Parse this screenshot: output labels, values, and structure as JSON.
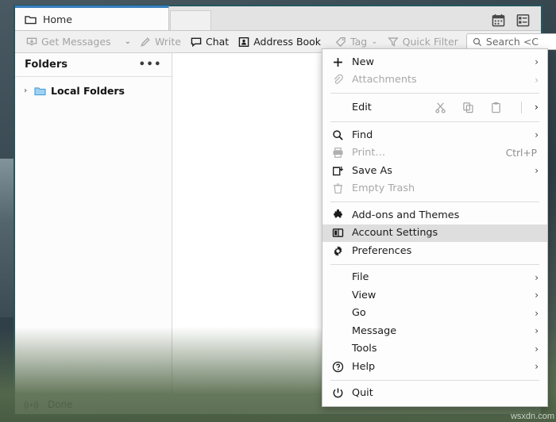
{
  "window": {
    "tabs": [
      {
        "label": "Home",
        "icon": "folder-icon",
        "active": true
      },
      {
        "label": "",
        "icon": "",
        "active": false
      }
    ],
    "tab_icons": [
      {
        "name": "calendar-icon"
      },
      {
        "name": "tasks-icon"
      }
    ]
  },
  "toolbar": {
    "get_messages": "Get Messages",
    "get_messages_caret": "⌄",
    "write": "Write",
    "chat": "Chat",
    "address_book": "Address Book",
    "tag": "Tag",
    "tag_caret": "⌄",
    "quick_filter": "Quick Filter",
    "search_value": "Search <C",
    "search_placeholder": "Search <Ctrl+K>",
    "menu_button": "app-menu-button"
  },
  "sidebar": {
    "title": "Folders",
    "more_label": "•••",
    "tree": [
      {
        "label": "Local Folders",
        "twisty": "›",
        "icon": "folder-icon"
      }
    ]
  },
  "statusbar": {
    "text": "Done",
    "icon": "activity-icon"
  },
  "appmenu": {
    "groups": [
      {
        "items": [
          {
            "label": "New",
            "icon": "plus-icon",
            "arrow": "›",
            "disabled": false,
            "selected": false,
            "accel": ""
          },
          {
            "label": "Attachments",
            "icon": "paperclip-icon",
            "arrow": "›",
            "disabled": true,
            "selected": false,
            "accel": ""
          }
        ]
      },
      {
        "edit_row": {
          "label": "Edit",
          "arrow": "›",
          "icons": [
            {
              "name": "cut-icon"
            },
            {
              "name": "copy-icon"
            },
            {
              "name": "paste-icon"
            }
          ]
        }
      },
      {
        "items": [
          {
            "label": "Find",
            "icon": "search-icon",
            "arrow": "›",
            "disabled": false,
            "selected": false,
            "accel": ""
          },
          {
            "label": "Print…",
            "icon": "printer-icon",
            "arrow": "",
            "disabled": true,
            "selected": false,
            "accel": "Ctrl+P"
          },
          {
            "label": "Save As",
            "icon": "save-as-icon",
            "arrow": "›",
            "disabled": false,
            "selected": false,
            "accel": ""
          },
          {
            "label": "Empty Trash",
            "icon": "trash-icon",
            "arrow": "",
            "disabled": true,
            "selected": false,
            "accel": ""
          }
        ]
      },
      {
        "items": [
          {
            "label": "Add-ons and Themes",
            "icon": "puzzle-icon",
            "arrow": "",
            "disabled": false,
            "selected": false,
            "accel": ""
          },
          {
            "label": "Account Settings",
            "icon": "panel-icon",
            "arrow": "",
            "disabled": false,
            "selected": true,
            "accel": ""
          },
          {
            "label": "Preferences",
            "icon": "gear-icon",
            "arrow": "",
            "disabled": false,
            "selected": false,
            "accel": ""
          }
        ]
      },
      {
        "items": [
          {
            "label": "File",
            "icon": "",
            "arrow": "›",
            "disabled": false,
            "selected": false,
            "accel": ""
          },
          {
            "label": "View",
            "icon": "",
            "arrow": "›",
            "disabled": false,
            "selected": false,
            "accel": ""
          },
          {
            "label": "Go",
            "icon": "",
            "arrow": "›",
            "disabled": false,
            "selected": false,
            "accel": ""
          },
          {
            "label": "Message",
            "icon": "",
            "arrow": "›",
            "disabled": false,
            "selected": false,
            "accel": ""
          },
          {
            "label": "Tools",
            "icon": "",
            "arrow": "›",
            "disabled": false,
            "selected": false,
            "accel": ""
          },
          {
            "label": "Help",
            "icon": "help-icon",
            "arrow": "›",
            "disabled": false,
            "selected": false,
            "accel": ""
          }
        ]
      },
      {
        "items": [
          {
            "label": "Quit",
            "icon": "power-icon",
            "arrow": "",
            "disabled": false,
            "selected": false,
            "accel": ""
          }
        ]
      }
    ]
  },
  "watermark": "wsxdn.com",
  "colors": {
    "active_tab_accent": "#3a7fc1",
    "window_border": "#24565e",
    "menu_selection": "#dedede",
    "folder_blue": "#6cb8e8"
  }
}
